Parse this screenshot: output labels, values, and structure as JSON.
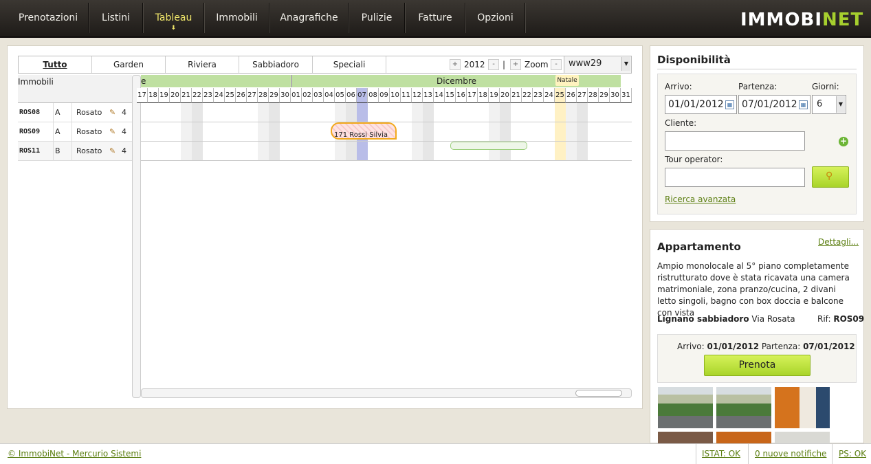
{
  "nav": {
    "items": [
      {
        "label": "Prenotazioni",
        "active": false
      },
      {
        "label": "Listini",
        "active": false
      },
      {
        "label": "Tableau",
        "active": true
      },
      {
        "label": "Immobili",
        "active": false
      },
      {
        "label": "Anagrafiche",
        "active": false
      },
      {
        "label": "Pulizie",
        "active": false
      },
      {
        "label": "Fatture",
        "active": false
      },
      {
        "label": "Opzioni",
        "active": false
      }
    ],
    "active_arrow": "⬇",
    "logo_part1": "IMMOBI",
    "logo_part2": "NET",
    "brand_color": "#a6cf2e"
  },
  "tableau": {
    "tabs": [
      "Tutto",
      "Garden",
      "Riviera",
      "Sabbiadoro",
      "Speciali"
    ],
    "active_tab": "Tutto",
    "year": "2012",
    "sep": "|",
    "zoom_label": "Zoom",
    "plus": "+",
    "minus": "-",
    "view_select": "www29",
    "immobili_label": "Immobili",
    "month_prev": "e",
    "month_current": "Dicembre",
    "holiday": "Natale",
    "days_prev": [
      "17",
      "18",
      "19",
      "20",
      "21",
      "22",
      "23",
      "24",
      "25",
      "26",
      "27",
      "28",
      "29",
      "30"
    ],
    "days_current": [
      "01",
      "02",
      "03",
      "04",
      "05",
      "06",
      "07",
      "08",
      "09",
      "10",
      "11",
      "12",
      "13",
      "14",
      "15",
      "16",
      "17",
      "18",
      "19",
      "20",
      "21",
      "22",
      "23",
      "24",
      "25",
      "26",
      "27",
      "28",
      "29",
      "30",
      "31"
    ],
    "rows": [
      {
        "code": "ROS08",
        "cat": "A",
        "name": "Rosato",
        "count": "4"
      },
      {
        "code": "ROS09",
        "cat": "A",
        "name": "Rosato",
        "count": "4"
      },
      {
        "code": "ROS11",
        "cat": "B",
        "name": "Rosato",
        "count": "4"
      }
    ],
    "booking": {
      "label": "171  Rossi Silvia"
    }
  },
  "disponibilita": {
    "title": "Disponibilità",
    "arrivo_label": "Arrivo:",
    "partenza_label": "Partenza:",
    "giorni_label": "Giorni:",
    "arrivo_value": "01/01/2012",
    "partenza_value": "07/01/2012",
    "giorni_value": "6",
    "cliente_label": "Cliente:",
    "cliente_value": "",
    "tour_label": "Tour operator:",
    "tour_value": "",
    "ricerca_link": "Ricerca avanzata"
  },
  "appartamento": {
    "title": "Appartamento",
    "dettagli": "Dettagli...",
    "description": "Ampio monolocale al 5° piano completamente ristrutturato dove è stata ricavata una camera matrimoniale, zona pranzo/cucina, 2 divani letto singoli, bagno con box doccia e balcone con vista",
    "location_bold": "Lignano sabbiadoro",
    "location_rest": " Via Rosata",
    "rif_label": "Rif: ",
    "rif_value": "ROS09",
    "arrivo_label": "Arrivo: ",
    "arrivo_value": "01/01/2012",
    "partenza_label": " Partenza: ",
    "partenza_value": "07/01/2012",
    "prenota": "Prenota"
  },
  "footer": {
    "copyright": "© ImmobiNet - Mercurio Sistemi",
    "istat": "ISTAT: OK",
    "notifiche": "0 nuove notifiche",
    "ps": "PS: OK"
  }
}
